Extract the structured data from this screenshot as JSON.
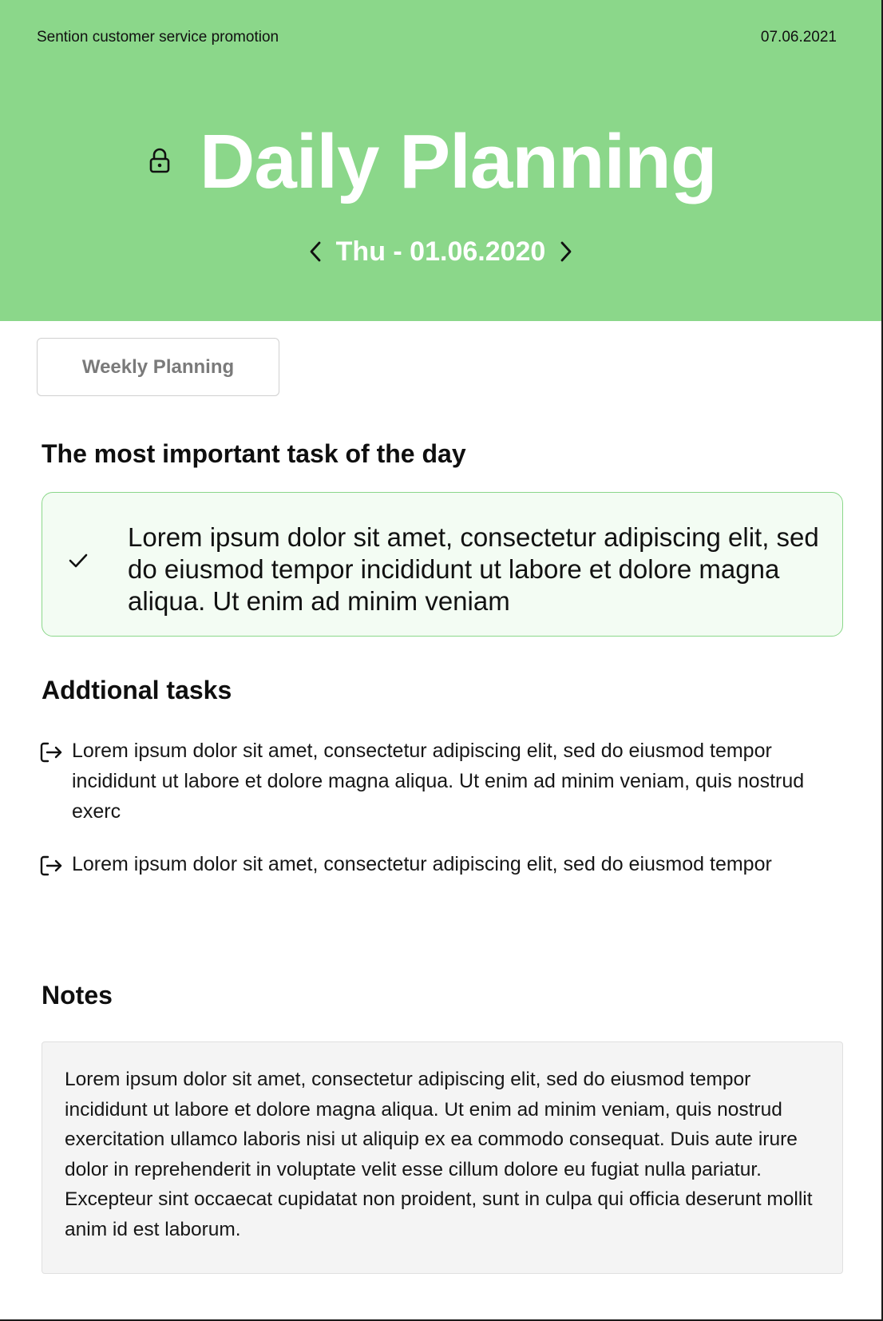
{
  "header": {
    "promo": "Sention customer service promotion",
    "date_top": "07.06.2021",
    "title": "Daily Planning",
    "current_date": "Thu - 01.06.2020",
    "icons": {
      "lock": "lock-icon",
      "prev": "chevron-left-icon",
      "next": "chevron-right-icon"
    }
  },
  "weekly_button": {
    "label": "Weekly Planning"
  },
  "main_task": {
    "heading": "The most important task of the day",
    "text": "Lorem ipsum dolor sit amet, consectetur adipiscing elit, sed do eiusmod tempor incididunt ut labore et dolore magna aliqua. Ut enim ad minim veniam",
    "icon": "check-icon"
  },
  "additional_tasks": {
    "heading": "Addtional tasks",
    "items": [
      {
        "text": "Lorem ipsum dolor sit amet, consectetur adipiscing elit, sed do eiusmod tempor incididunt ut labore et dolore magna aliqua. Ut enim ad minim veniam, quis nostrud exerc",
        "icon": "arrow-right-bracket-icon"
      },
      {
        "text": "Lorem ipsum dolor sit amet, consectetur adipiscing elit, sed do eiusmod tempor",
        "icon": "arrow-right-bracket-icon"
      }
    ]
  },
  "notes": {
    "heading": "Notes",
    "text": "Lorem ipsum dolor sit amet, consectetur adipiscing elit, sed do eiusmod tempor incididunt ut labore et dolore magna aliqua. Ut enim ad minim veniam, quis nostrud exercitation ullamco laboris nisi ut aliquip ex ea commodo consequat. Duis aute irure dolor in reprehenderit in voluptate velit esse cillum dolore eu fugiat nulla pariatur. Excepteur sint occaecat cupidatat non proident, sunt in culpa qui officia deserunt mollit anim id est laborum."
  },
  "colors": {
    "header_bg": "#8bd78a",
    "main_card_bg": "#f3fcf3",
    "main_card_border": "#8bd78a",
    "notes_bg": "#f4f4f4"
  }
}
